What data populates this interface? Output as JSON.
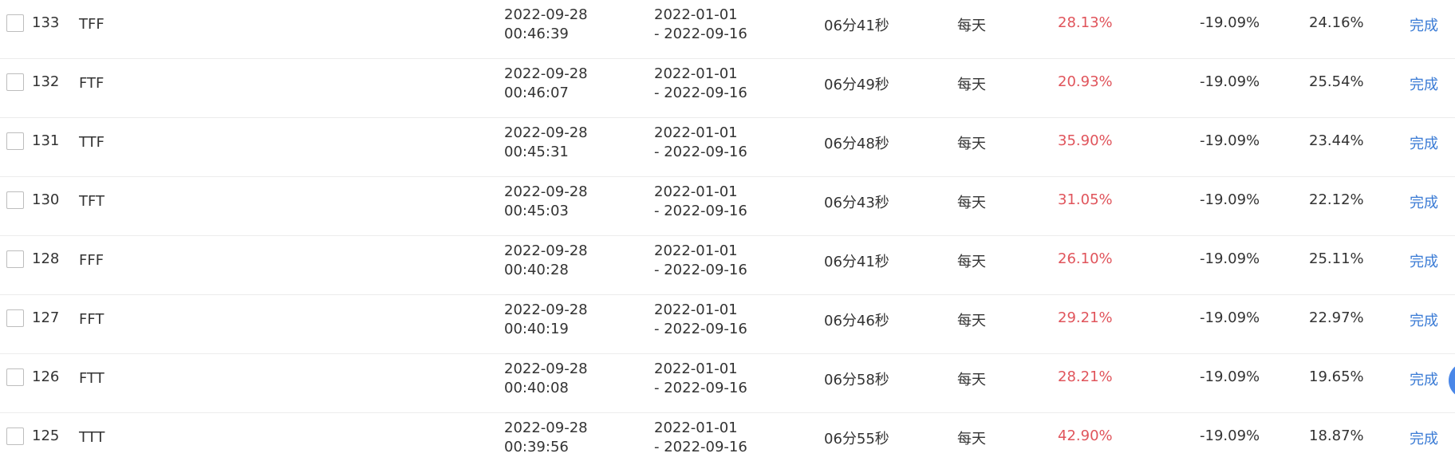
{
  "rows": [
    {
      "id": "133",
      "name": "TFF",
      "time_date": "2022-09-28",
      "time_clock": "00:46:39",
      "range_start": "2022-01-01",
      "range_end": "- 2022-09-16",
      "duration": "06分41秒",
      "frequency": "每天",
      "return": "28.13%",
      "benchmark": "-19.09%",
      "excess": "24.16%",
      "status": "完成"
    },
    {
      "id": "132",
      "name": "FTF",
      "time_date": "2022-09-28",
      "time_clock": "00:46:07",
      "range_start": "2022-01-01",
      "range_end": "- 2022-09-16",
      "duration": "06分49秒",
      "frequency": "每天",
      "return": "20.93%",
      "benchmark": "-19.09%",
      "excess": "25.54%",
      "status": "完成"
    },
    {
      "id": "131",
      "name": "TTF",
      "time_date": "2022-09-28",
      "time_clock": "00:45:31",
      "range_start": "2022-01-01",
      "range_end": "- 2022-09-16",
      "duration": "06分48秒",
      "frequency": "每天",
      "return": "35.90%",
      "benchmark": "-19.09%",
      "excess": "23.44%",
      "status": "完成"
    },
    {
      "id": "130",
      "name": "TFT",
      "time_date": "2022-09-28",
      "time_clock": "00:45:03",
      "range_start": "2022-01-01",
      "range_end": "- 2022-09-16",
      "duration": "06分43秒",
      "frequency": "每天",
      "return": "31.05%",
      "benchmark": "-19.09%",
      "excess": "22.12%",
      "status": "完成"
    },
    {
      "id": "128",
      "name": "FFF",
      "time_date": "2022-09-28",
      "time_clock": "00:40:28",
      "range_start": "2022-01-01",
      "range_end": "- 2022-09-16",
      "duration": "06分41秒",
      "frequency": "每天",
      "return": "26.10%",
      "benchmark": "-19.09%",
      "excess": "25.11%",
      "status": "完成"
    },
    {
      "id": "127",
      "name": "FFT",
      "time_date": "2022-09-28",
      "time_clock": "00:40:19",
      "range_start": "2022-01-01",
      "range_end": "- 2022-09-16",
      "duration": "06分46秒",
      "frequency": "每天",
      "return": "29.21%",
      "benchmark": "-19.09%",
      "excess": "22.97%",
      "status": "完成"
    },
    {
      "id": "126",
      "name": "FTT",
      "time_date": "2022-09-28",
      "time_clock": "00:40:08",
      "range_start": "2022-01-01",
      "range_end": "- 2022-09-16",
      "duration": "06分58秒",
      "frequency": "每天",
      "return": "28.21%",
      "benchmark": "-19.09%",
      "excess": "19.65%",
      "status": "完成"
    },
    {
      "id": "125",
      "name": "TTT",
      "time_date": "2022-09-28",
      "time_clock": "00:39:56",
      "range_start": "2022-01-01",
      "range_end": "- 2022-09-16",
      "duration": "06分55秒",
      "frequency": "每天",
      "return": "42.90%",
      "benchmark": "-19.09%",
      "excess": "18.87%",
      "status": "完成"
    }
  ],
  "colors": {
    "return_text": "#e0545b",
    "status_link": "#3a7bd5",
    "floating_button": "#4a87e8"
  }
}
